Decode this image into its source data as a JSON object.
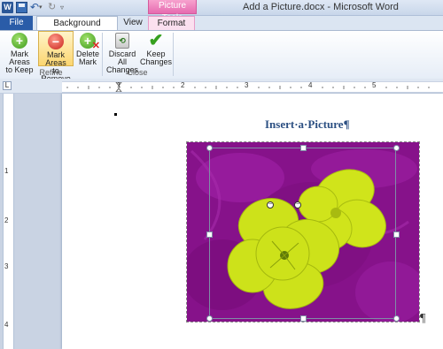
{
  "window": {
    "title": "Add a Picture.docx  -  Microsoft Word",
    "contextual_tab_group": "Picture Tools",
    "app_icon_letter": "W"
  },
  "quick_access": {
    "icons": [
      "word-icon",
      "save-icon",
      "undo-icon",
      "redo-icon",
      "customize-icon"
    ]
  },
  "tabs": {
    "file": "File",
    "background_removal": "Background Removal",
    "view": "View",
    "format": "Format"
  },
  "ribbon": {
    "refine": {
      "label": "Refine",
      "mark_keep": {
        "line1": "Mark Areas",
        "line2": "to Keep",
        "icon": "plus-icon"
      },
      "mark_remove": {
        "line1": "Mark Areas",
        "line2": "to Remove",
        "icon": "minus-icon",
        "selected": true
      },
      "delete_mark": {
        "line1": "Delete",
        "line2": "Mark",
        "icon": "delete-mark-icon"
      }
    },
    "close": {
      "label": "Close",
      "discard": {
        "line1": "Discard All",
        "line2": "Changes",
        "icon": "discard-icon"
      },
      "keep": {
        "line1": "Keep",
        "line2": "Changes",
        "icon": "checkmark-icon"
      }
    }
  },
  "ruler": {
    "tab_selector": "L",
    "h_numbers": [
      "1",
      "2",
      "3",
      "4",
      "5"
    ],
    "v_numbers": [
      "1",
      "2",
      "3",
      "4"
    ]
  },
  "document": {
    "heading": "Insert·a·Picture¶",
    "end_mark": "¶"
  },
  "colors": {
    "background_removed": "#8a138c",
    "flower": "#cde21a",
    "heading": "#2b4f82",
    "file_tab": "#2a5ca8",
    "picture_tools": "#e66bb0"
  }
}
